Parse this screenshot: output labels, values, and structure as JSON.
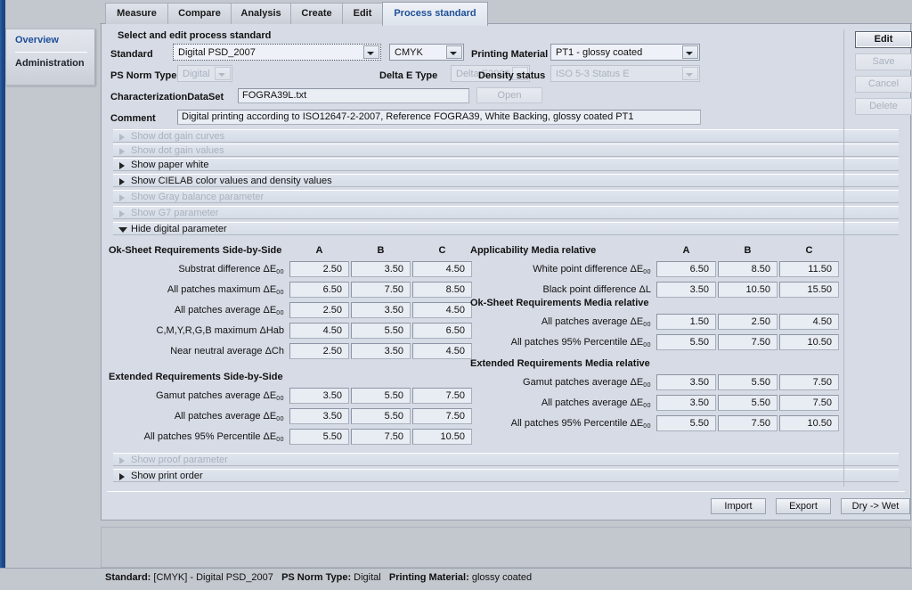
{
  "sidebar": {
    "items": [
      {
        "label": "Overview",
        "selected": true
      },
      {
        "label": "Administration",
        "selected": false
      }
    ]
  },
  "tabs": [
    {
      "label": "Measure",
      "active": false
    },
    {
      "label": "Compare",
      "active": false
    },
    {
      "label": "Analysis",
      "active": false
    },
    {
      "label": "Create",
      "active": false
    },
    {
      "label": "Edit",
      "active": false
    },
    {
      "label": "Process standard",
      "active": true
    }
  ],
  "form": {
    "section_title": "Select and edit process standard",
    "standard_label": "Standard",
    "standard_value": "Digital PSD_2007",
    "colorspace_value": "CMYK",
    "printing_material_label": "Printing Material",
    "printing_material_value": "PT1 - glossy coated",
    "ps_norm_type_label": "PS Norm Type",
    "ps_norm_type_value": "Digital",
    "delta_e_type_label": "Delta E Type",
    "delta_e_type_value": "Delta E2000",
    "density_status_label": "Density status",
    "density_status_value": "ISO 5-3 Status E",
    "charset_label": "CharacterizationDataSet",
    "charset_value": "FOGRA39L.txt",
    "open_button": "Open",
    "comment_label": "Comment",
    "comment_value": "Digital printing according to ISO12647-2-2007,  Reference  FOGRA39, White Backing, glossy coated PT1"
  },
  "sections": [
    {
      "label": "Show dot gain curves",
      "state": "disabled",
      "expanded": false
    },
    {
      "label": "Show dot gain values",
      "state": "disabled",
      "expanded": false
    },
    {
      "label": "Show paper white",
      "state": "enabled",
      "expanded": false
    },
    {
      "label": "Show CIELAB color values and density values",
      "state": "enabled",
      "expanded": false
    },
    {
      "label": "Show Gray balance parameter",
      "state": "disabled",
      "expanded": false
    },
    {
      "label": "Show G7 parameter",
      "state": "disabled",
      "expanded": false
    },
    {
      "label": "Hide digital parameter",
      "state": "enabled",
      "expanded": true
    }
  ],
  "sections_bottom": [
    {
      "label": "Show proof parameter",
      "state": "disabled",
      "expanded": false
    },
    {
      "label": "Show print order",
      "state": "enabled",
      "expanded": false
    }
  ],
  "columns": [
    "A",
    "B",
    "C"
  ],
  "digital_parameter": {
    "left_groups": [
      {
        "title": "Ok-Sheet Requirements Side-by-Side",
        "has_columns": true,
        "rows": [
          {
            "label": "Substrat difference ΔE",
            "sub": "00",
            "values": [
              "2.50",
              "3.50",
              "4.50"
            ]
          },
          {
            "label": "All patches maximum ΔE",
            "sub": "00",
            "values": [
              "6.50",
              "7.50",
              "8.50"
            ]
          },
          {
            "label": "All patches average ΔE",
            "sub": "00",
            "values": [
              "2.50",
              "3.50",
              "4.50"
            ]
          },
          {
            "label": "C,M,Y,R,G,B maximum ΔHab",
            "sub": "",
            "values": [
              "4.50",
              "5.50",
              "6.50"
            ]
          },
          {
            "label": "Near neutral average ΔCh",
            "sub": "",
            "values": [
              "2.50",
              "3.50",
              "4.50"
            ]
          }
        ]
      },
      {
        "title": "Extended Requirements Side-by-Side",
        "has_columns": false,
        "rows": [
          {
            "label": "Gamut patches average ΔE",
            "sub": "00",
            "values": [
              "3.50",
              "5.50",
              "7.50"
            ]
          },
          {
            "label": "All patches average ΔE",
            "sub": "00",
            "values": [
              "3.50",
              "5.50",
              "7.50"
            ]
          },
          {
            "label": "All patches 95% Percentile ΔE",
            "sub": "00",
            "values": [
              "5.50",
              "7.50",
              "10.50"
            ]
          }
        ]
      }
    ],
    "right_groups": [
      {
        "title": "Applicability Media relative",
        "has_columns": true,
        "rows": [
          {
            "label": "White point difference ΔE",
            "sub": "00",
            "values": [
              "6.50",
              "8.50",
              "11.50"
            ]
          },
          {
            "label": "Black point difference ΔL",
            "sub": "",
            "values": [
              "3.50",
              "10.50",
              "15.50"
            ]
          }
        ]
      },
      {
        "title": "Ok-Sheet Requirements Media relative",
        "has_columns": false,
        "rows": [
          {
            "label": "All patches average ΔE",
            "sub": "00",
            "values": [
              "1.50",
              "2.50",
              "4.50"
            ]
          },
          {
            "label": "All patches 95% Percentile ΔE",
            "sub": "00",
            "values": [
              "5.50",
              "7.50",
              "10.50"
            ]
          }
        ]
      },
      {
        "title": "Extended Requirements Media relative",
        "has_columns": false,
        "rows": [
          {
            "label": "Gamut patches average ΔE",
            "sub": "00",
            "values": [
              "3.50",
              "5.50",
              "7.50"
            ]
          },
          {
            "label": "All patches average ΔE",
            "sub": "00",
            "values": [
              "3.50",
              "5.50",
              "7.50"
            ]
          },
          {
            "label": "All patches 95% Percentile ΔE",
            "sub": "00",
            "values": [
              "5.50",
              "7.50",
              "10.50"
            ]
          }
        ]
      }
    ]
  },
  "side_buttons": [
    {
      "label": "Edit",
      "state": "enabled"
    },
    {
      "label": "Save",
      "state": "disabled"
    },
    {
      "label": "Cancel",
      "state": "disabled"
    },
    {
      "label": "Delete",
      "state": "disabled"
    }
  ],
  "footer_buttons": [
    {
      "label": "Import",
      "state": "enabled"
    },
    {
      "label": "Export",
      "state": "enabled"
    },
    {
      "label": "Dry -> Wet",
      "state": "enabled"
    }
  ],
  "statusbar": {
    "standard_key": "Standard:",
    "standard_val": "[CMYK] - Digital PSD_2007",
    "norm_key": "PS Norm Type:",
    "norm_val": "Digital",
    "material_key": "Printing Material:",
    "material_val": "glossy coated"
  },
  "colors": {
    "rail_blue": "#1b4a8b",
    "accent_text": "#1d4f97",
    "window_bg": "#c3c7ce",
    "panel_bg": "#d6dbe5"
  }
}
